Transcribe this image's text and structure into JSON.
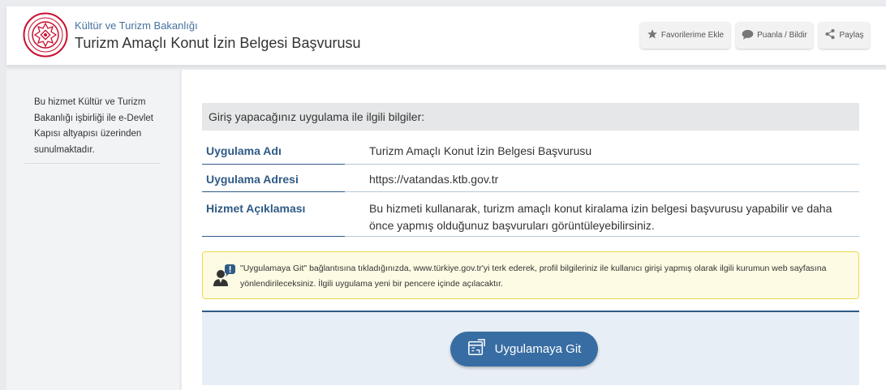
{
  "header": {
    "ministry": "Kültür ve Turizm Bakanlığı",
    "title": "Turizm Amaçlı Konut İzin Belgesi Başvurusu",
    "buttons": {
      "favorite": "Favorilerime Ekle",
      "rate": "Puanla / Bildir",
      "share": "Paylaş"
    }
  },
  "sidebar": {
    "text": "Bu hizmet Kültür ve Turizm Bakanlığı işbirliği ile e-Devlet Kapısı altyapısı üzerinden sunulmaktadır."
  },
  "main": {
    "info_header": "Giriş yapacağınız uygulama ile ilgili bilgiler:",
    "rows": [
      {
        "label": "Uygulama Adı",
        "value": "Turizm Amaçlı Konut İzin Belgesi Başvurusu"
      },
      {
        "label": "Uygulama Adresi",
        "value": "https://vatandas.ktb.gov.tr"
      },
      {
        "label": "Hizmet Açıklaması",
        "value": "Bu hizmeti kullanarak, turizm amaçlı konut kiralama izin belgesi başvurusu yapabilir ve daha önce yapmış olduğunuz başvuruları görüntüleyebilirsiniz."
      }
    ],
    "notice": "\"Uygulamaya Git\" bağlantısına tıkladığınızda, www.türkiye.gov.tr'yi terk ederek, profil bilgileriniz ile kullanıcı girişi yapmış olarak ilgili kurumun web sayfasına yönlendirileceksiniz. İlgili uygulama yeni bir pencere içinde açılacaktır.",
    "go_button": "Uygulamaya Git"
  },
  "icons": {
    "favorite": "star-icon",
    "rate": "speech-bubble-icon",
    "share": "share-icon",
    "notice": "user-alert-icon",
    "go": "external-window-icon"
  },
  "colors": {
    "accent": "#2f5b86",
    "button": "#386da3",
    "logo": "#c8102e",
    "notice_bg": "#fdfbe3",
    "notice_border": "#ecd94c"
  }
}
